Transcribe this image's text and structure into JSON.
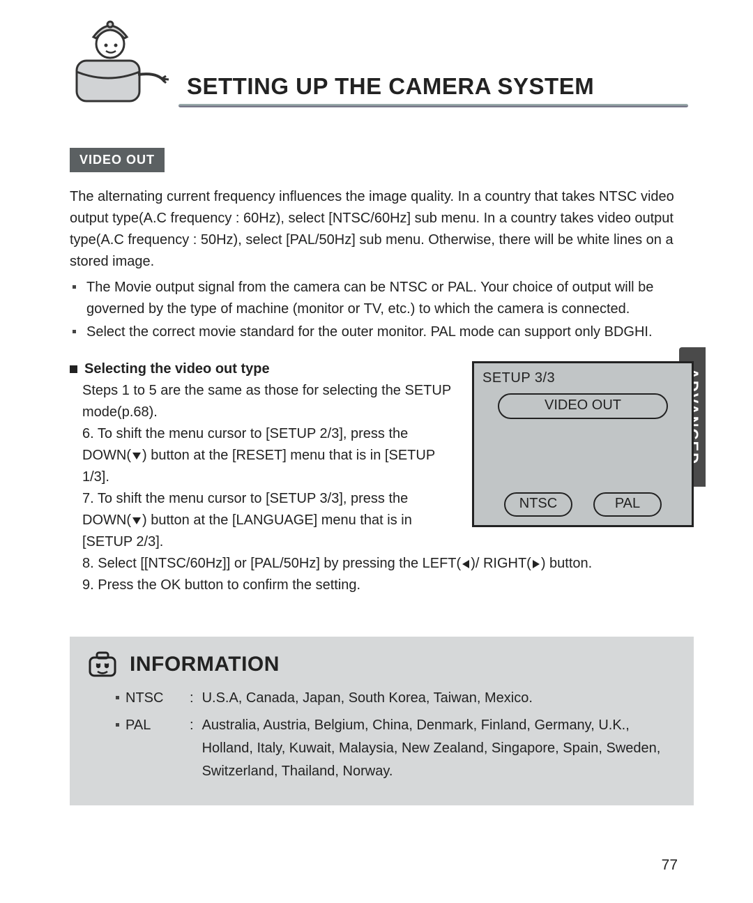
{
  "header": {
    "title": "SETTING UP THE CAMERA SYSTEM"
  },
  "tab": {
    "label": "ADVANCED"
  },
  "section": {
    "label": "VIDEO OUT"
  },
  "intro": "The alternating current frequency influences the image quality. In a country that takes NTSC video output type(A.C frequency : 60Hz), select [NTSC/60Hz] sub menu. In a country takes video output type(A.C frequency : 50Hz), select [PAL/50Hz] sub menu. Otherwise, there will be white lines on a stored image.",
  "bullets": [
    "The Movie output signal from the camera can be NTSC or PAL. Your choice of output will be governed by the type of machine (monitor or TV, etc.) to which the camera is connected.",
    "Select the correct movie standard for the outer monitor. PAL mode can support only BDGHI."
  ],
  "subhead": "Selecting the video out type",
  "steps": {
    "lead": "Steps 1 to 5 are the same as those for selecting the SETUP mode(p.68).",
    "s6a": "6. To shift the menu cursor to [SETUP 2/3], press the DOWN(",
    "s6b": ") button at the [RESET] menu that is in [SETUP 1/3].",
    "s7a": "7. To shift the menu cursor to [SETUP 3/3], press the DOWN(",
    "s7b": ") button at the [LANGUAGE] menu that is in [SETUP 2/3].",
    "s8a": "8. Select [[NTSC/60Hz]] or [PAL/50Hz] by pressing the LEFT(",
    "s8b": ")/ RIGHT(",
    "s8c": ") button.",
    "s9": "9. Press the OK button to confirm the setting."
  },
  "screen": {
    "title": "SETUP 3/3",
    "menu": "VIDEO OUT",
    "opt1": "NTSC",
    "opt2": "PAL"
  },
  "info": {
    "title": "INFORMATION",
    "ntsc_label": "NTSC",
    "ntsc_text": "U.S.A, Canada, Japan, South Korea, Taiwan, Mexico.",
    "pal_label": "PAL",
    "pal_text": "Australia, Austria, Belgium, China, Denmark, Finland, Germany, U.K., Holland, Italy, Kuwait, Malaysia, New Zealand, Singapore, Spain, Sweden, Switzerland, Thailand, Norway."
  },
  "page_number": "77"
}
